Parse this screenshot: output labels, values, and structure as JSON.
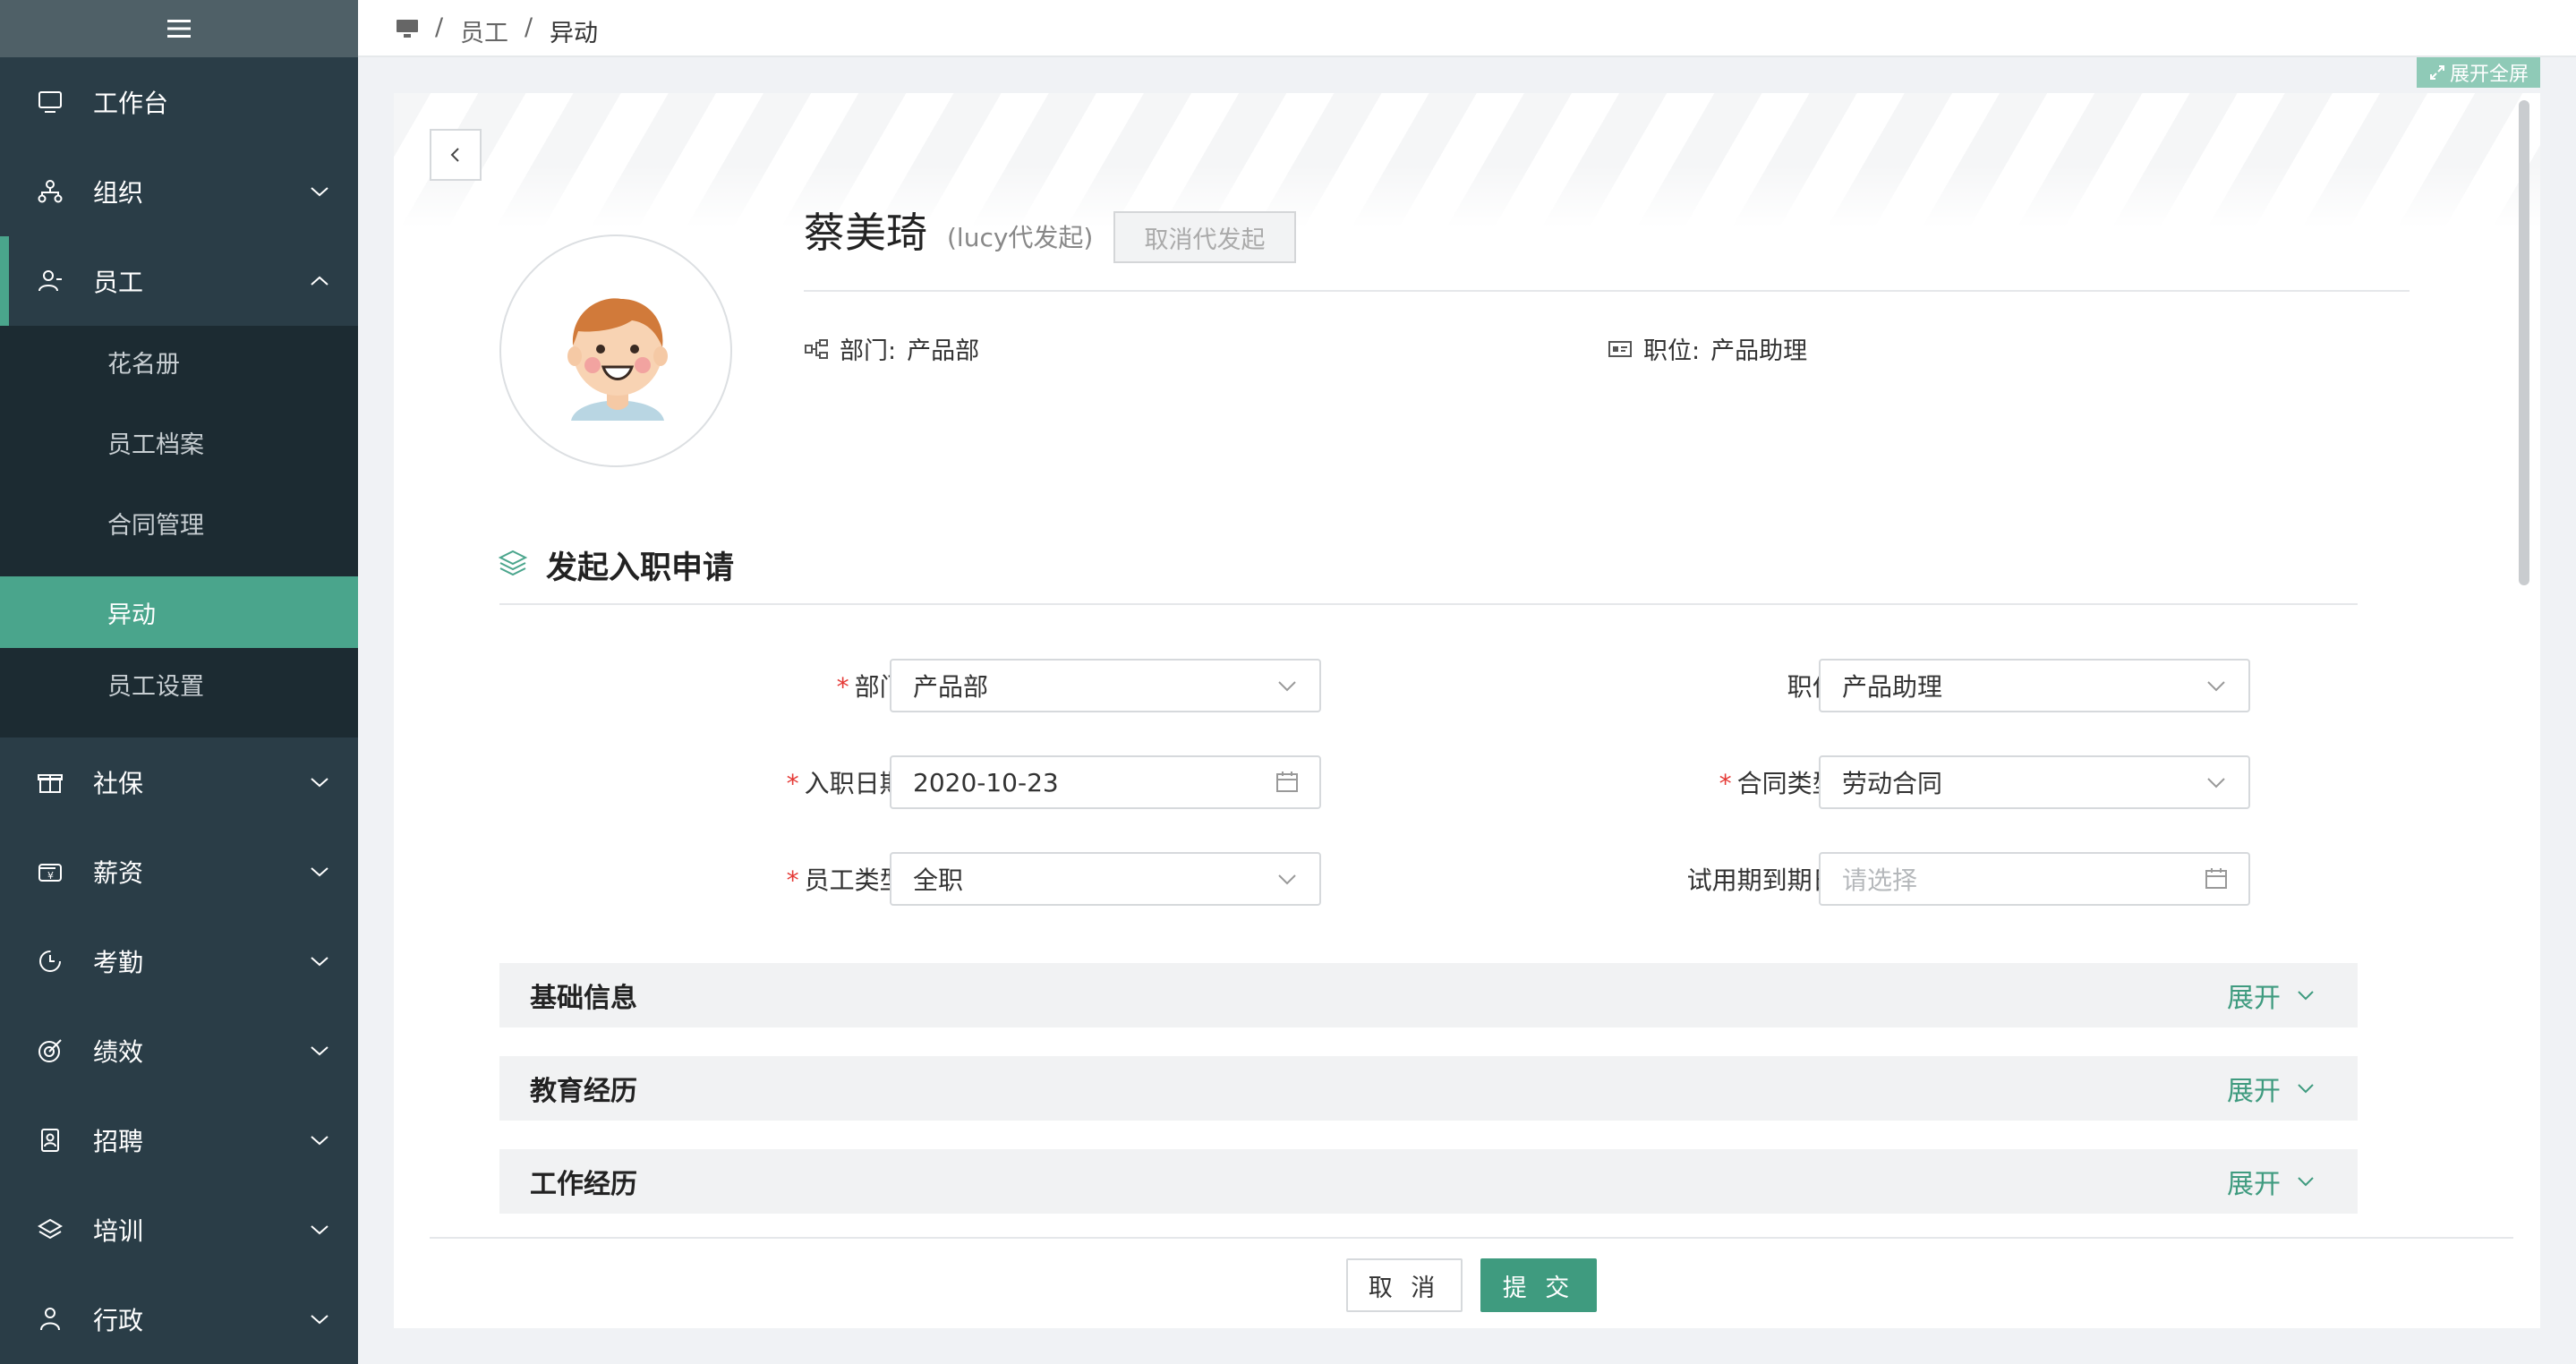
{
  "sidebar": {
    "toggle_icon": "menu-icon",
    "items": [
      {
        "label": "工作台",
        "icon": "monitor-icon"
      },
      {
        "label": "组织",
        "icon": "org-icon"
      },
      {
        "label": "员工",
        "icon": "user-icon",
        "expanded": true
      },
      {
        "label": "社保",
        "icon": "gift-icon"
      },
      {
        "label": "薪资",
        "icon": "wallet-icon"
      },
      {
        "label": "考勤",
        "icon": "clock-icon"
      },
      {
        "label": "绩效",
        "icon": "target-icon"
      },
      {
        "label": "招聘",
        "icon": "badge-icon"
      },
      {
        "label": "培训",
        "icon": "layers-icon"
      },
      {
        "label": "行政",
        "icon": "person-icon"
      }
    ],
    "sub_items": [
      {
        "label": "花名册"
      },
      {
        "label": "员工档案"
      },
      {
        "label": "合同管理"
      },
      {
        "label": "异动",
        "active": true
      },
      {
        "label": "员工设置"
      }
    ]
  },
  "breadcrumb": {
    "sep": "/",
    "level1": "员工",
    "level2": "异动"
  },
  "fullscreen_label": "展开全屏",
  "profile": {
    "name": "蔡美琦",
    "proxy_note": "(lucy代发起)",
    "cancel_proxy_label": "取消代发起",
    "dept_label": "部门:",
    "dept_value": "产品部",
    "position_label": "职位:",
    "position_value": "产品助理"
  },
  "section": {
    "title": "发起入职申请"
  },
  "form": {
    "dept": {
      "label": "部门:",
      "value": "产品部",
      "required": true
    },
    "position": {
      "label": "职位:",
      "value": "产品助理",
      "required": false
    },
    "entry_date": {
      "label": "入职日期:",
      "value": "2020-10-23",
      "required": true
    },
    "contract_type": {
      "label": "合同类型:",
      "value": "劳动合同",
      "required": true
    },
    "employee_type": {
      "label": "员工类型:",
      "value": "全职",
      "required": true
    },
    "probation_end": {
      "label": "试用期到期日:",
      "placeholder": "请选择",
      "required": false
    }
  },
  "panels": [
    {
      "title": "基础信息",
      "action": "展开"
    },
    {
      "title": "教育经历",
      "action": "展开"
    },
    {
      "title": "工作经历",
      "action": "展开"
    }
  ],
  "actions": {
    "cancel": "取 消",
    "submit": "提 交"
  },
  "colors": {
    "sidebar": "#2a3d47",
    "submenu": "#1c2b32",
    "accent": "#4aa58c",
    "primary": "#3f9b7f",
    "required": "#e53935"
  }
}
